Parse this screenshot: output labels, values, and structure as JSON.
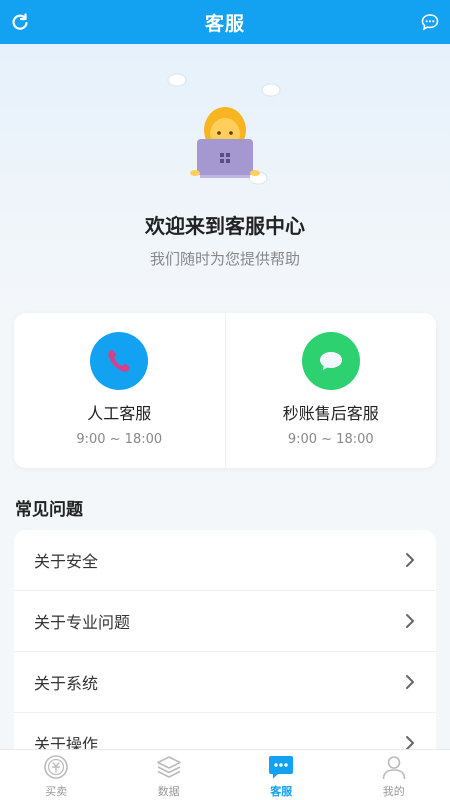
{
  "header": {
    "title": "客服",
    "left_icon": "refresh-icon",
    "right_icon": "chat-bubble-icon"
  },
  "hero": {
    "welcome": "欢迎来到客服中心",
    "subtitle": "我们随时为您提供帮助",
    "illustration": "support-agent-illustration"
  },
  "services": [
    {
      "name": "人工客服",
      "hours": "9:00 ~ 18:00",
      "icon": "phone-icon",
      "color": "#13a2f2"
    },
    {
      "name": "秒账售后客服",
      "hours": "9:00 ~ 18:00",
      "icon": "speech-bubble-icon",
      "color": "#2ed16f"
    }
  ],
  "faq": {
    "title": "常见问题",
    "items": [
      {
        "label": "关于安全"
      },
      {
        "label": "关于专业问题"
      },
      {
        "label": "关于系统"
      },
      {
        "label": "关于操作"
      }
    ]
  },
  "tabbar": {
    "active_color": "#13a2f2",
    "tabs": [
      {
        "label": "买卖",
        "icon": "trade-coin-icon",
        "active": false
      },
      {
        "label": "数据",
        "icon": "layers-icon",
        "active": false
      },
      {
        "label": "客服",
        "icon": "chat-icon",
        "active": true
      },
      {
        "label": "我的",
        "icon": "user-icon",
        "active": false
      }
    ]
  }
}
